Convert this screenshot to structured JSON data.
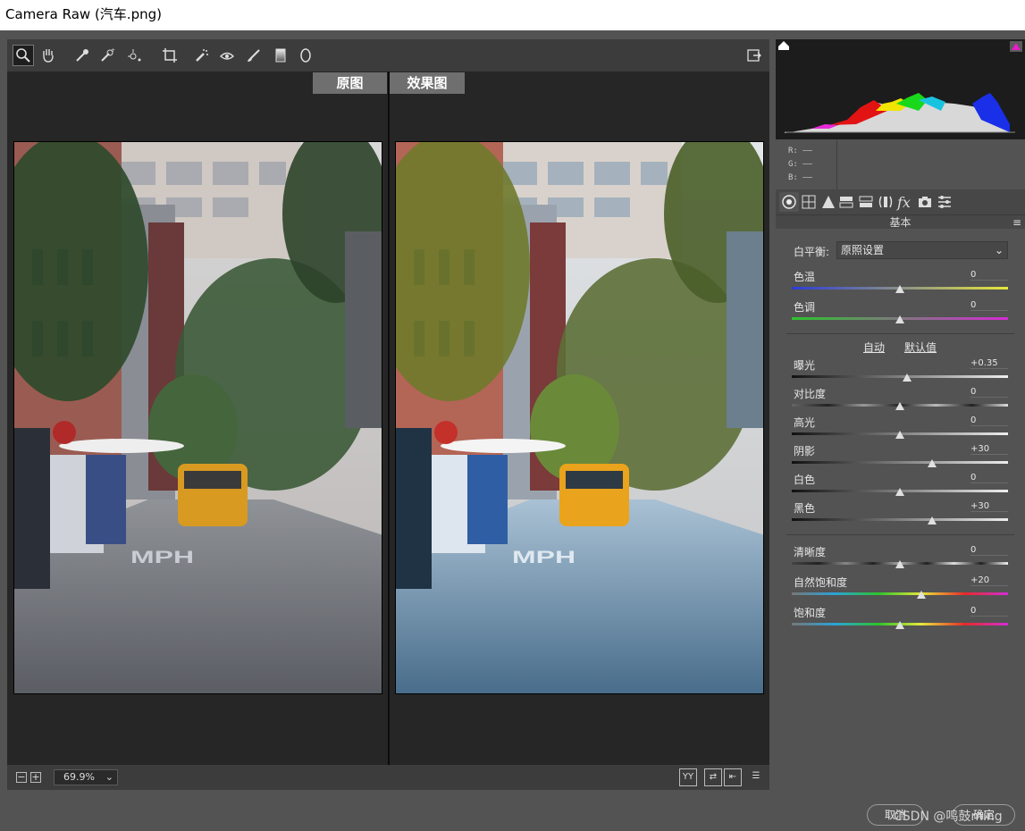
{
  "window": {
    "title": "Camera Raw (汽车.png)"
  },
  "toolbar": {
    "tools": [
      {
        "name": "zoom-tool-icon"
      },
      {
        "name": "hand-tool-icon"
      },
      {
        "name": "white-balance-tool-icon"
      },
      {
        "name": "color-sampler-tool-icon"
      },
      {
        "name": "targeted-adjustment-tool-icon"
      },
      {
        "name": "crop-tool-icon"
      },
      {
        "name": "spot-removal-tool-icon"
      },
      {
        "name": "red-eye-tool-icon"
      },
      {
        "name": "adjustment-brush-icon"
      },
      {
        "name": "graduated-filter-icon"
      },
      {
        "name": "radial-filter-icon"
      }
    ]
  },
  "views": {
    "before_label": "原图",
    "after_label": "效果图"
  },
  "zoom": {
    "minus": "−",
    "plus": "+",
    "level": "69.9%"
  },
  "colors": {
    "panel_bg": "#535353",
    "dark_bg": "#262626",
    "accent_label": "#6f6f6f"
  },
  "histogram": {
    "rgb": {
      "r_label": "R:",
      "g_label": "G:",
      "b_label": "B:",
      "r_value": "——",
      "g_value": "——",
      "b_value": "——"
    }
  },
  "panel": {
    "title": "基本",
    "white_balance_label": "白平衡:",
    "white_balance_value": "原照设置",
    "auto_label": "自动",
    "default_label": "默认值",
    "sliders": [
      {
        "label": "色温",
        "value": "0",
        "level": 0.5
      },
      {
        "label": "色调",
        "value": "0",
        "level": 0.5
      },
      {
        "label": "曝光",
        "value": "+0.35",
        "level": 0.535
      },
      {
        "label": "对比度",
        "value": "0",
        "level": 0.5
      },
      {
        "label": "高光",
        "value": "0",
        "level": 0.5
      },
      {
        "label": "阴影",
        "value": "+30",
        "level": 0.65
      },
      {
        "label": "白色",
        "value": "0",
        "level": 0.5
      },
      {
        "label": "黑色",
        "value": "+30",
        "level": 0.65
      },
      {
        "label": "清晰度",
        "value": "0",
        "level": 0.5
      },
      {
        "label": "自然饱和度",
        "value": "+20",
        "level": 0.6
      },
      {
        "label": "饱和度",
        "value": "0",
        "level": 0.5
      }
    ]
  },
  "footer": {
    "cancel": "取消",
    "ok": "确定",
    "watermark": "CSDN @鸣鼓ming"
  }
}
